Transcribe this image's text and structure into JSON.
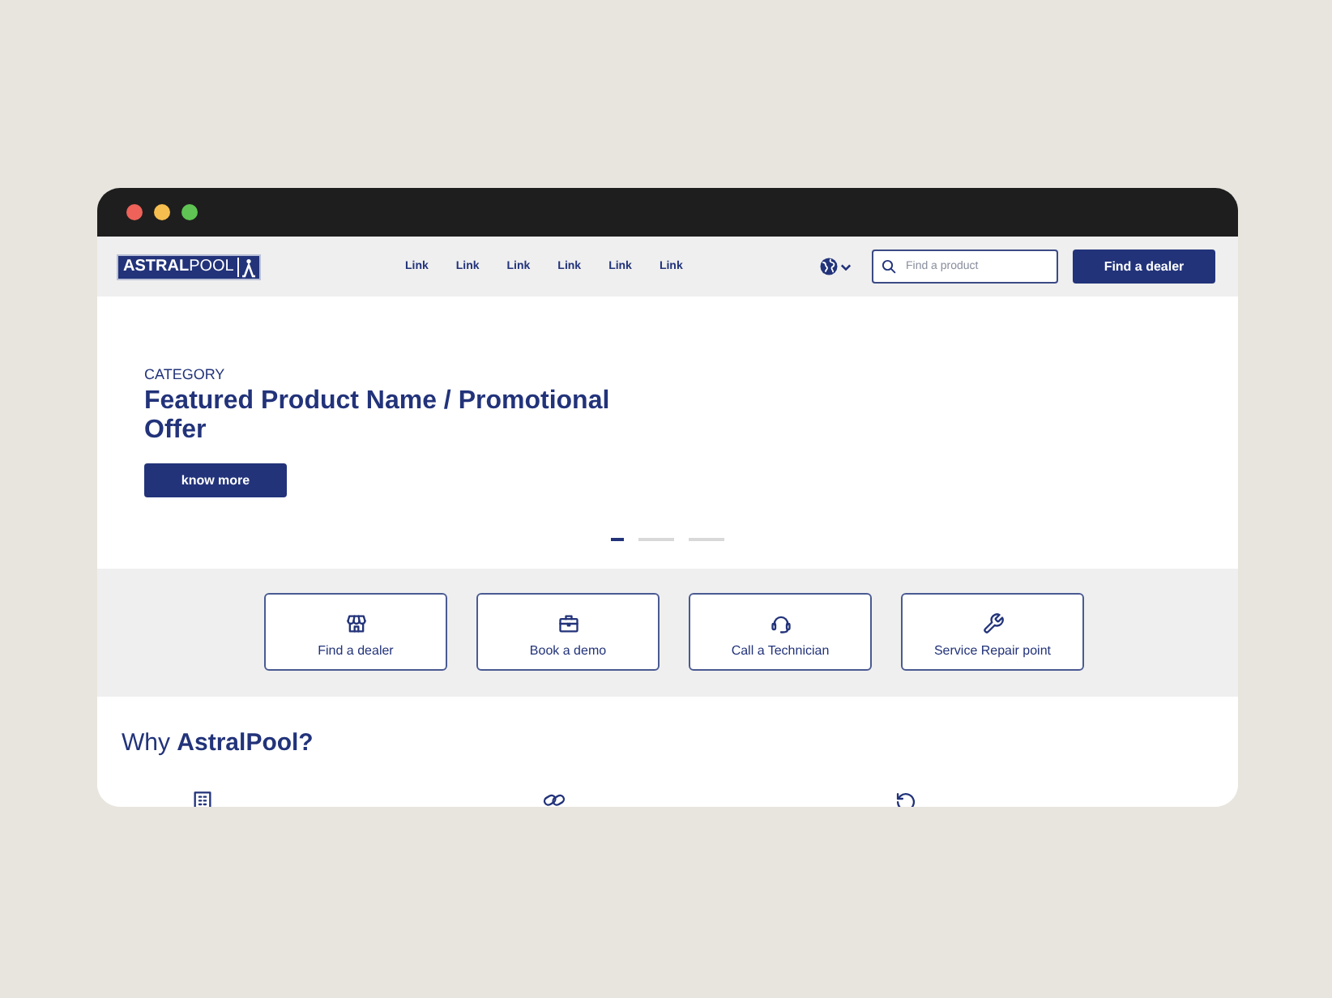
{
  "window": {
    "controls": [
      {
        "color": "#ee6259"
      },
      {
        "color": "#f6be4f"
      },
      {
        "color": "#5fc453"
      }
    ]
  },
  "header": {
    "logo": "**ASTRAL**POOL",
    "links": [
      "Link",
      "Link",
      "Link",
      "Link",
      "Link",
      "Link"
    ],
    "search": {
      "placeholder": "Find a product"
    },
    "button": "Find a dealer"
  },
  "hero": {
    "category": "CATEGORY",
    "title": "Featured Product Name / Promotional Offer",
    "button": "know more",
    "slides": [
      {
        "selected": true
      },
      {
        "selected": false
      },
      {
        "selected": false
      }
    ]
  },
  "quick_actions": [
    {
      "kind": "store",
      "label": "Find a dealer"
    },
    {
      "kind": "briefcase",
      "label": "Book a demo"
    },
    {
      "kind": "headset",
      "label": "Call a Technician"
    },
    {
      "kind": "wrench",
      "label": "Service Repair point"
    }
  ],
  "why": {
    "title": "Why **AstralPool?**",
    "features": [
      {
        "kind": "building"
      },
      {
        "kind": "link"
      },
      {
        "kind": "history"
      }
    ]
  }
}
